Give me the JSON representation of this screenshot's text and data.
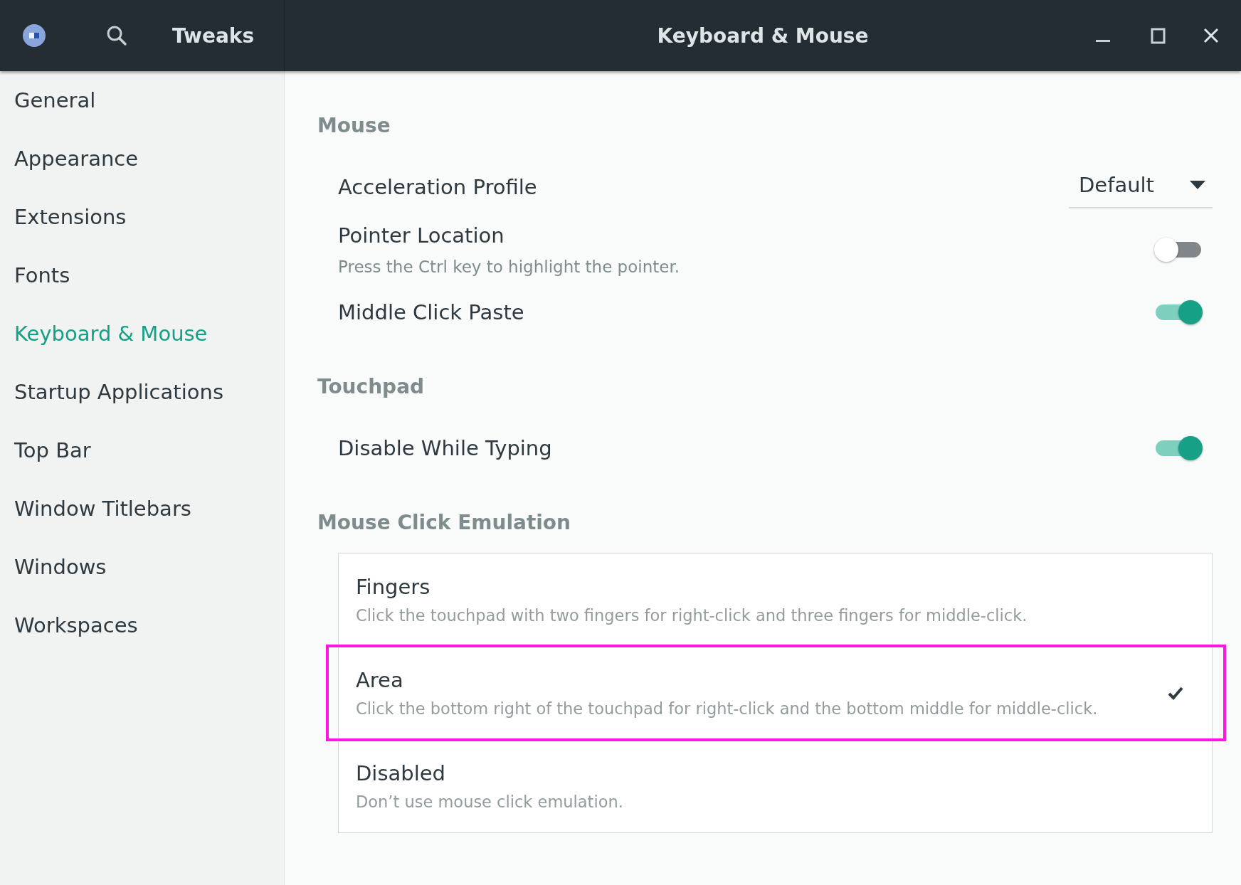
{
  "header": {
    "app_title": "Tweaks",
    "page_title": "Keyboard & Mouse"
  },
  "sidebar": {
    "items": [
      {
        "label": "General",
        "selected": false
      },
      {
        "label": "Appearance",
        "selected": false
      },
      {
        "label": "Extensions",
        "selected": false
      },
      {
        "label": "Fonts",
        "selected": false
      },
      {
        "label": "Keyboard & Mouse",
        "selected": true
      },
      {
        "label": "Startup Applications",
        "selected": false
      },
      {
        "label": "Top Bar",
        "selected": false
      },
      {
        "label": "Window Titlebars",
        "selected": false
      },
      {
        "label": "Windows",
        "selected": false
      },
      {
        "label": "Workspaces",
        "selected": false
      }
    ]
  },
  "sections": [
    {
      "title": "Mouse",
      "rows": [
        {
          "kind": "dropdown",
          "label": "Acceleration Profile",
          "value": "Default"
        },
        {
          "kind": "switch",
          "label": "Pointer Location",
          "description": "Press the Ctrl key to highlight the pointer.",
          "on": false
        },
        {
          "kind": "switch",
          "label": "Middle Click Paste",
          "on": true
        }
      ]
    },
    {
      "title": "Touchpad",
      "rows": [
        {
          "kind": "switch",
          "label": "Disable While Typing",
          "on": true
        }
      ]
    },
    {
      "title": "Mouse Click Emulation",
      "options": [
        {
          "label": "Fingers",
          "description": "Click the touchpad with two fingers for right-click and three fingers for middle-click.",
          "selected": false,
          "highlighted": false
        },
        {
          "label": "Area",
          "description": "Click the bottom right of the touchpad for right-click and the bottom middle for middle-click.",
          "selected": true,
          "highlighted": true
        },
        {
          "label": "Disabled",
          "description": "Don’t use mouse click emulation.",
          "selected": false,
          "highlighted": false
        }
      ]
    }
  ]
}
